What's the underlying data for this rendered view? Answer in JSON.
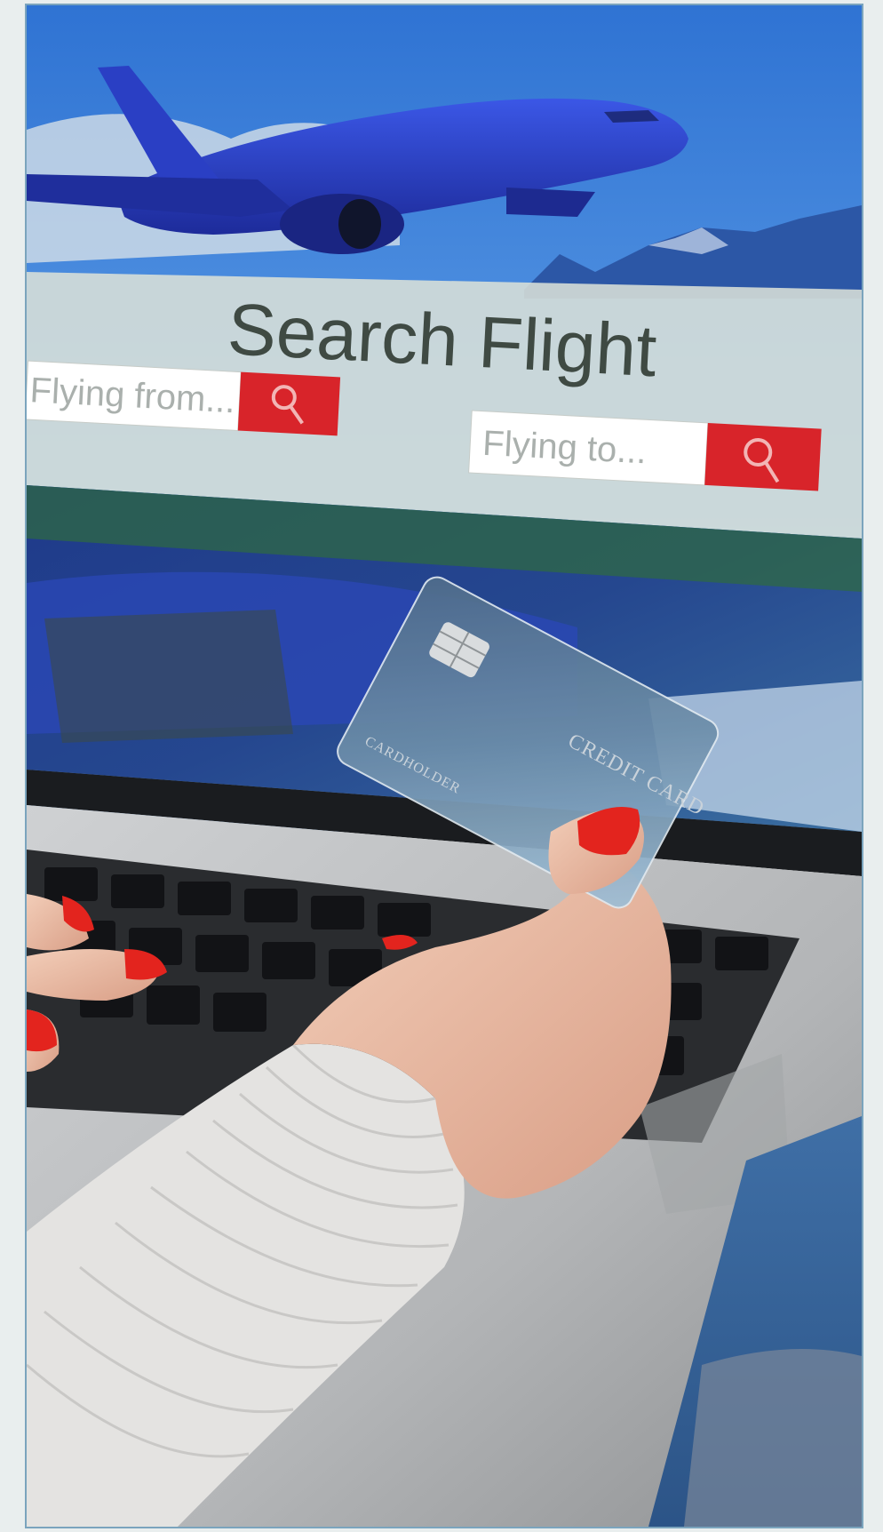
{
  "screen": {
    "title": "Search Flight",
    "from_placeholder": "Flying from...",
    "to_placeholder": "Flying to..."
  },
  "card": {
    "brand_text": "CREDIT CARD",
    "holder_text": "CARDHOLDER"
  },
  "icons": {
    "from_search": "search-icon",
    "to_search": "search-icon",
    "chip": "chip-icon"
  },
  "colors": {
    "sky": "#3f86d8",
    "airplane": "#2a3fc4",
    "search_button": "#d8242a",
    "nail_polish": "#e3241e",
    "laptop": "#b9bbbd",
    "sweater": "#e4e3e1",
    "frame_border": "#7ba4bd"
  }
}
